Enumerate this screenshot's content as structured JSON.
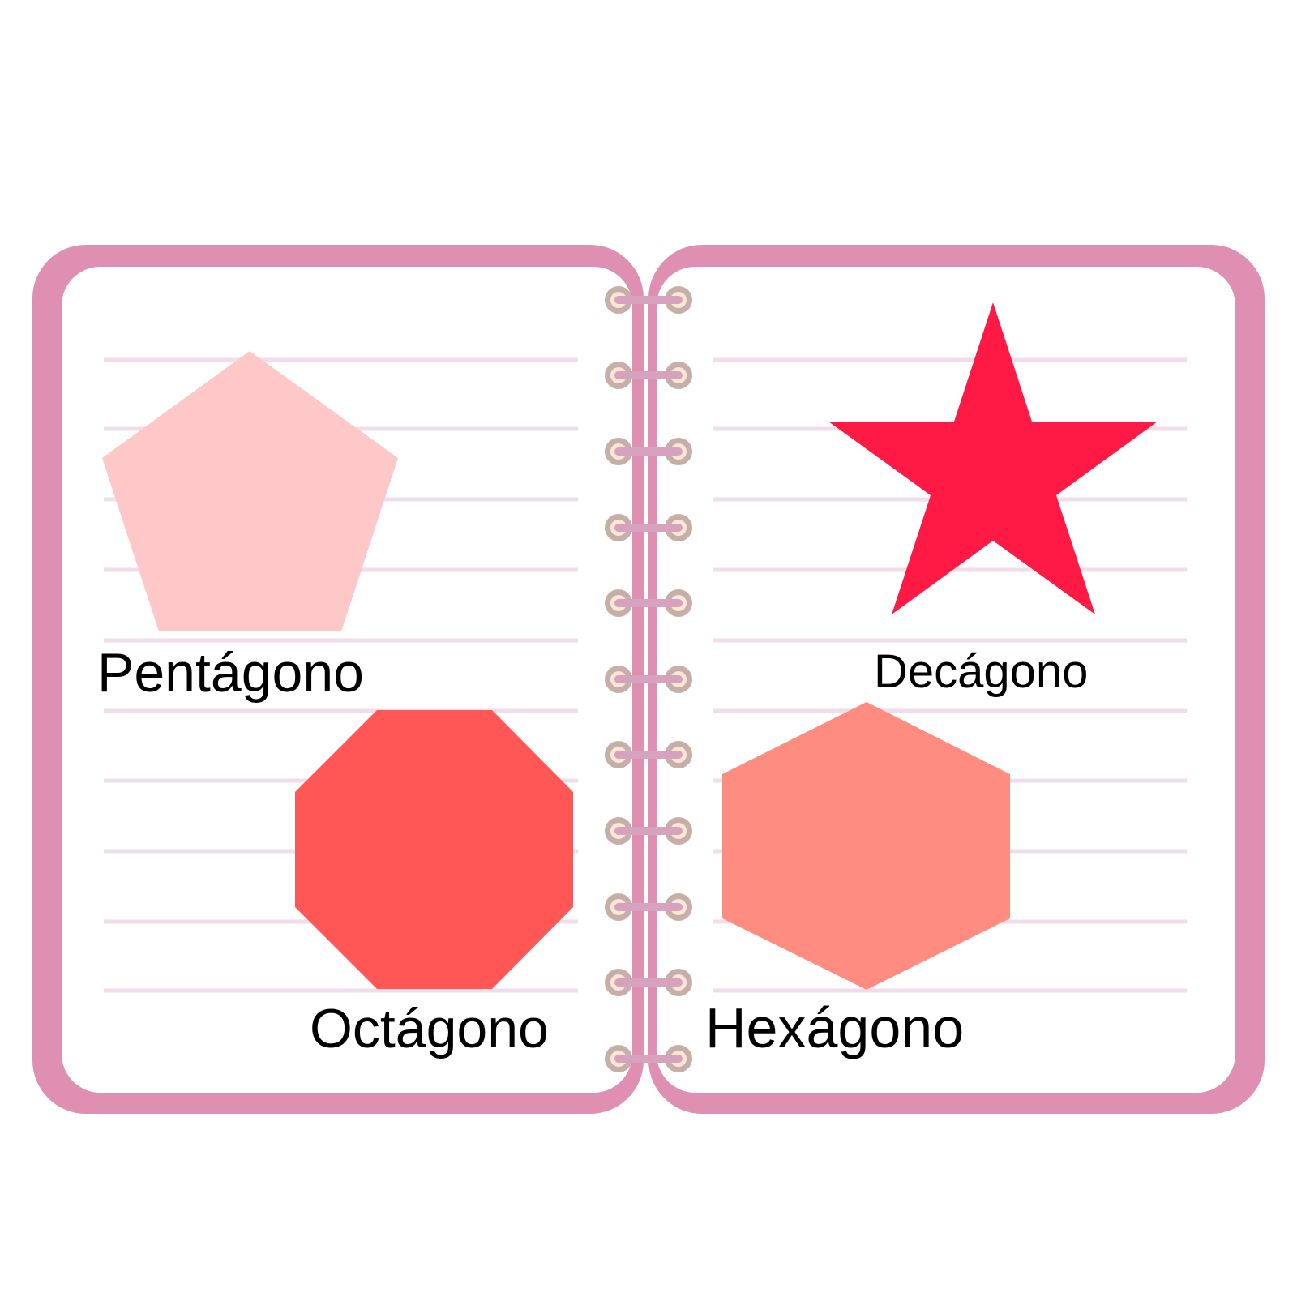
{
  "notebook": {
    "cover_color": "#DE8FB2",
    "page_color": "#FFFFFF",
    "line_color": "#F1DDEA",
    "ring_outer_color": "#C6AFA8",
    "ring_inner_color": "#F9E6D3",
    "ring_bar_color": "#D6A2BE"
  },
  "shapes": {
    "pentagon": {
      "label": "Pentágono",
      "color": "#FFC8C8",
      "icon": "pentagon-icon"
    },
    "decagon": {
      "label": "Decágono",
      "color": "#FF1A45",
      "icon": "star-icon"
    },
    "octagon": {
      "label": "Octágono",
      "color": "#FF5656",
      "icon": "octagon-icon"
    },
    "hexagon": {
      "label": "Hexágono",
      "color": "#FF8C80",
      "icon": "hexagon-icon"
    }
  }
}
